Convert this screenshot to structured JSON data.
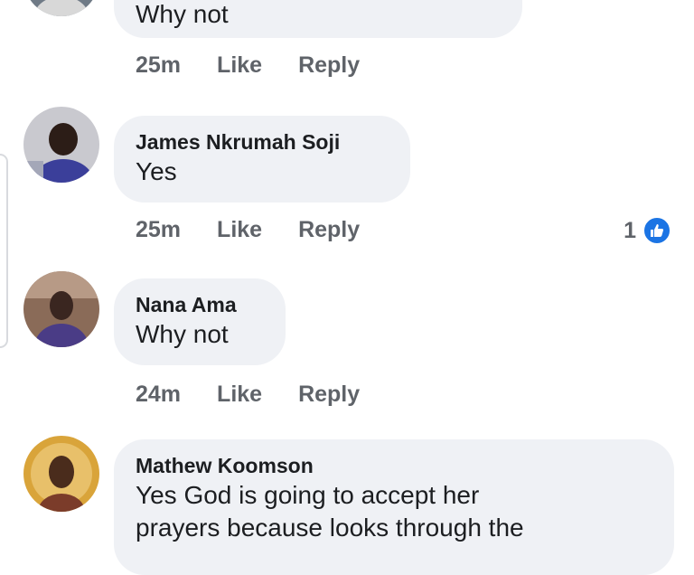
{
  "comments": [
    {
      "author": "",
      "text": "Why not",
      "time": "25m",
      "like_label": "Like",
      "reply_label": "Reply"
    },
    {
      "author": "James Nkrumah Soji",
      "text": "Yes",
      "time": "25m",
      "like_label": "Like",
      "reply_label": "Reply",
      "reaction_count": "1",
      "reaction_icon": "thumbs-up-icon",
      "reaction_color": "#1b74e4"
    },
    {
      "author": "Nana Ama",
      "text": "Why not",
      "time": "24m",
      "like_label": "Like",
      "reply_label": "Reply"
    },
    {
      "author": "Mathew Koomson",
      "text_line1": "Yes God is going to accept her",
      "text_line2": "prayers because looks through the"
    }
  ],
  "colors": {
    "bubble": "#eff1f5",
    "meta_text": "#5f6369",
    "accent": "#1b74e4"
  }
}
